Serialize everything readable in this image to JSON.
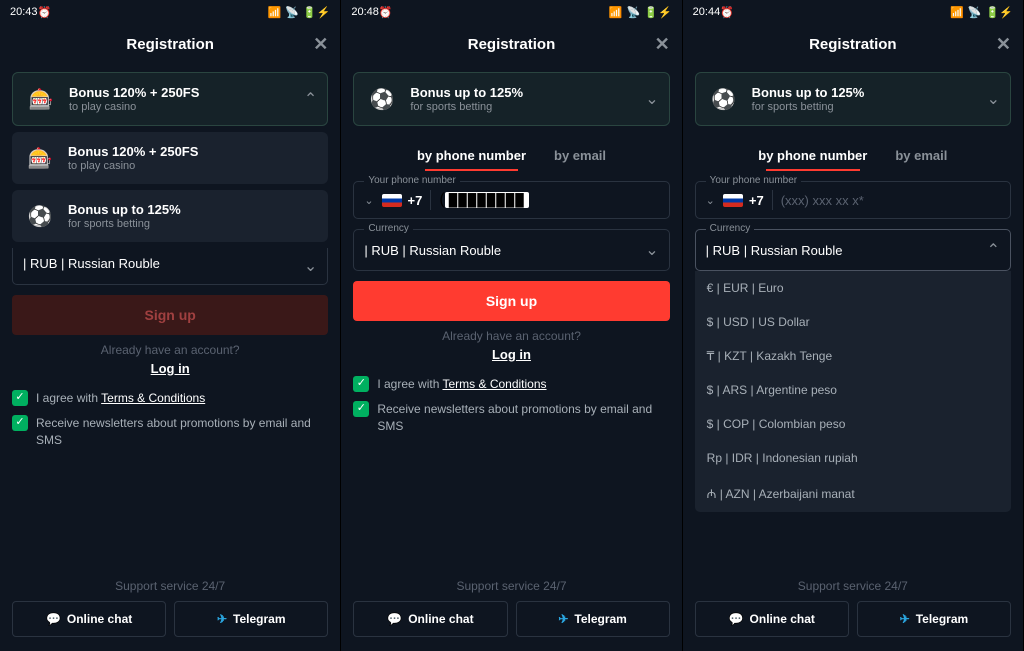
{
  "screens": [
    {
      "time": "20:43"
    },
    {
      "time": "20:48"
    },
    {
      "time": "20:44"
    }
  ],
  "header": {
    "title": "Registration"
  },
  "bonus": {
    "casino": {
      "title": "Bonus 120% + 250FS",
      "sub": "to play casino"
    },
    "sports": {
      "title": "Bonus up to 125%",
      "sub": "for sports betting"
    }
  },
  "tabs": {
    "phone": "by phone number",
    "email": "by email"
  },
  "phone": {
    "label": "Your phone number",
    "code": "+7",
    "placeholder": "(xxx) xxx xx x*",
    "masked_prefix": "("
  },
  "currency": {
    "label": "Currency",
    "selected": "| RUB | Russian Rouble",
    "options": [
      "€ | EUR | Euro",
      "$ | USD | US Dollar",
      "₸ | KZT | Kazakh Tenge",
      "$ | ARS | Argentine peso",
      "$ | COP | Colombian peso",
      "Rp | IDR | Indonesian rupiah",
      "₼ | AZN | Azerbaijani manat"
    ]
  },
  "signup": "Sign up",
  "already": "Already have an account?",
  "login": "Log in",
  "agree_prefix": "I agree with ",
  "tc": "Terms & Conditions",
  "newsletter": "Receive newsletters about promotions by email and SMS",
  "support": "Support service 24/7",
  "chat": "Online chat",
  "telegram": "Telegram"
}
